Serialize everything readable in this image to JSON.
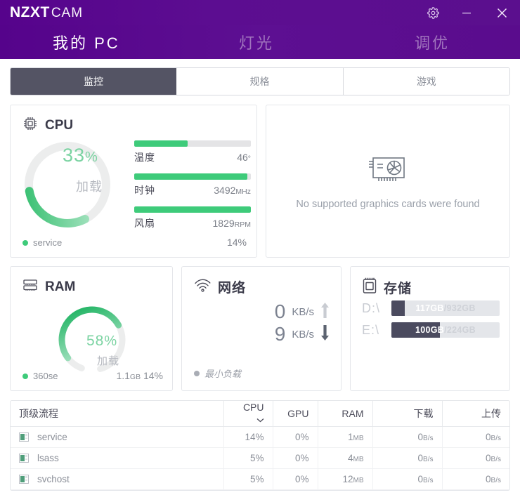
{
  "window": {
    "logo_bold": "NZXT",
    "logo_light": "CAM",
    "settings_icon": "gear-icon",
    "minimize_icon": "minimize-icon",
    "close_icon": "close-icon",
    "accent_purple": "#58068e",
    "accent_green": "#3ecb7a",
    "accent_dark": "#4b4b5f"
  },
  "nav": {
    "items": [
      {
        "label": "我的 PC",
        "active": true
      },
      {
        "label": "灯光",
        "active": false
      },
      {
        "label": "调优",
        "active": false
      }
    ]
  },
  "tabs": [
    {
      "label": "监控",
      "active": true
    },
    {
      "label": "规格",
      "active": false
    },
    {
      "label": "游戏",
      "active": false
    }
  ],
  "cpu": {
    "title": "CPU",
    "icon": "cpu-chip-icon",
    "gauge_value": "33",
    "gauge_pct_sign": "%",
    "gauge_percent": 33,
    "gauge_sub": "加载",
    "legend_name": "service",
    "legend_value": "14%",
    "stats": [
      {
        "name": "温度",
        "value": "46",
        "unit": "°",
        "percent": 46
      },
      {
        "name": "时钟",
        "value": "3492",
        "unit": "MHz",
        "percent": 97
      },
      {
        "name": "风扇",
        "value": "1829",
        "unit": "RPM",
        "percent": 100
      }
    ]
  },
  "gpu": {
    "icon": "graphics-card-icon",
    "message": "No supported graphics cards were found"
  },
  "ram": {
    "title": "RAM",
    "icon": "ram-stick-icon",
    "gauge_value": "58",
    "gauge_pct_sign": "%",
    "gauge_percent": 58,
    "gauge_sub": "加载",
    "legend_name": "360se",
    "value_size": "1.1",
    "value_size_unit": "GB",
    "value_pct": "14%"
  },
  "network": {
    "title": "网络",
    "icon": "wifi-icon",
    "upload_value": "0",
    "upload_unit": "KB/s",
    "upload_icon": "arrow-up-icon",
    "download_value": "9",
    "download_unit": "KB/s",
    "download_icon": "arrow-down-icon",
    "legend_name": "最小负载"
  },
  "storage": {
    "title": "存储",
    "icon": "storage-drive-icon",
    "drives": [
      {
        "letter": "D:\\",
        "used": "117GB",
        "sep": " / ",
        "total": "932GB",
        "percent": 12.5
      },
      {
        "letter": "E:\\",
        "used": "100GB",
        "sep": " / ",
        "total": "224GB",
        "percent": 45
      }
    ]
  },
  "process_table": {
    "columns": [
      {
        "label": "顶级流程",
        "sorted": false
      },
      {
        "label": "CPU",
        "sorted": true,
        "sort_icon": "chevron-down-icon"
      },
      {
        "label": "GPU",
        "sorted": false
      },
      {
        "label": "RAM",
        "sorted": false
      },
      {
        "label": "下载",
        "sorted": false
      },
      {
        "label": "上传",
        "sorted": false
      }
    ],
    "rows": [
      {
        "icon": "app-window-icon",
        "name": "service",
        "cpu": "14%",
        "gpu": "0%",
        "ram_value": "1",
        "ram_unit": "MB",
        "dl_value": "0",
        "dl_unit": "B/s",
        "ul_value": "0",
        "ul_unit": "B/s"
      },
      {
        "icon": "app-window-icon",
        "name": "lsass",
        "cpu": "5%",
        "gpu": "0%",
        "ram_value": "4",
        "ram_unit": "MB",
        "dl_value": "0",
        "dl_unit": "B/s",
        "ul_value": "0",
        "ul_unit": "B/s"
      },
      {
        "icon": "app-window-icon",
        "name": "svchost",
        "cpu": "5%",
        "gpu": "0%",
        "ram_value": "12",
        "ram_unit": "MB",
        "dl_value": "0",
        "dl_unit": "B/s",
        "ul_value": "0",
        "ul_unit": "B/s"
      }
    ]
  }
}
